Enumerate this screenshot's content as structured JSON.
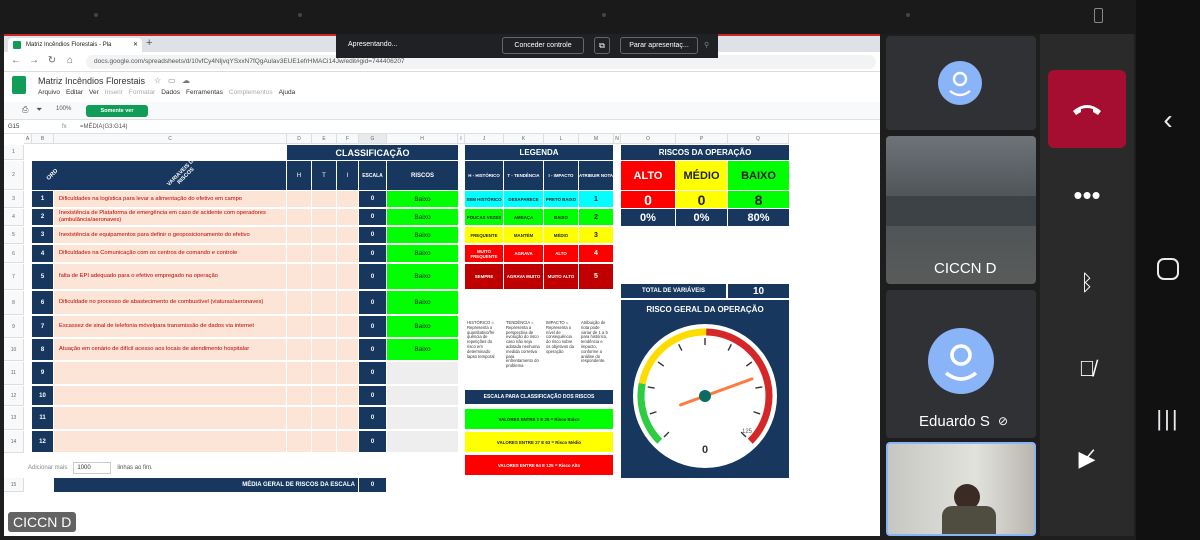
{
  "browser": {
    "tab_title": "Matriz Incêndios Florestais - Pla",
    "new_tab": "+",
    "url": "docs.google.com/spreadsheets/d/10vfCy4NljvqYSxxN7fQgAulav3EUE1efrHMACi14Jw/edit#gid=744406207"
  },
  "sheet": {
    "title": "Matriz Incêndios Florestais",
    "menu": [
      "Arquivo",
      "Editar",
      "Ver",
      "Inserir",
      "Formatar",
      "Dados",
      "Ferramentas",
      "Complementos",
      "Ajuda"
    ],
    "menu_dim": [
      3,
      4,
      7
    ],
    "zoom": "100%",
    "view_only": "Somente ver",
    "cell_ref": "G15",
    "formula": "=MÉDIA(G3:G14)",
    "columns": [
      "A",
      "B",
      "C",
      "D",
      "E",
      "F",
      "G",
      "H",
      "I",
      "J",
      "K",
      "L",
      "M",
      "N",
      "O",
      "P",
      "Q"
    ],
    "rows": [
      "1",
      "2",
      "3",
      "4",
      "5",
      "6",
      "7",
      "8",
      "9",
      "10",
      "11",
      "12",
      "13",
      "14",
      "15"
    ],
    "classificacao": "CLASSIFICAÇÃO",
    "col_ord": "ORD",
    "col_variaveis": "VARIÁVEIS DE RISCOS",
    "col_h": "H",
    "col_t": "T",
    "col_i": "I",
    "col_escala": "ESCALA",
    "col_riscos": "RISCOS",
    "items": [
      {
        "ord": "1",
        "text": "Dificuldades na logística para levar a alimentação do efetivo em campo",
        "escala": "0",
        "risco": "Baixo"
      },
      {
        "ord": "2",
        "text": "Inexistência de Plataforma de emergência em caso de acidente com operadores (ambulância/aeronaves)",
        "escala": "0",
        "risco": "Baixo"
      },
      {
        "ord": "3",
        "text": "Inexistência de equipamentos para definir o geoposicionamento do efetivo",
        "escala": "0",
        "risco": "Baixo"
      },
      {
        "ord": "4",
        "text": "Dificuldades na Comunicação com os centros de comando e controle",
        "escala": "0",
        "risco": "Baixo"
      },
      {
        "ord": "5",
        "text": "falta de EPI adequado para o efetivo empregado na operação",
        "escala": "0",
        "risco": "Baixo"
      },
      {
        "ord": "6",
        "text": "Dificuldade no processo de abastecimento de combustível (viaturas/aeronaves)",
        "escala": "0",
        "risco": "Baixo"
      },
      {
        "ord": "7",
        "text": "Escassez de sinal de telefonia móvelpara transmissão de dados via internet",
        "escala": "0",
        "risco": "Baixo"
      },
      {
        "ord": "8",
        "text": "Atuação em cenário de difícil acesso aos locais de atendimento hospitalar",
        "escala": "0",
        "risco": "Baixo"
      },
      {
        "ord": "9",
        "text": "",
        "escala": "0",
        "risco": ""
      },
      {
        "ord": "10",
        "text": "",
        "escala": "0",
        "risco": ""
      },
      {
        "ord": "11",
        "text": "",
        "escala": "0",
        "risco": ""
      },
      {
        "ord": "12",
        "text": "",
        "escala": "0",
        "risco": ""
      }
    ],
    "media_label": "MÉDIA GERAL DE RISCOS DA ESCALA",
    "media_value": "0",
    "legenda": {
      "title": "LEGENDA",
      "headers": [
        "H - HISTÓRICO",
        "T - TENDÊNCIA",
        "I - IMPACTO",
        "ATRIBUIR NOTA"
      ],
      "rows": [
        [
          "SEM HISTÓRICO",
          "DESAPARECE",
          "PRETO BAIXO",
          "1"
        ],
        [
          "POUCAS VEZES",
          "AMEAÇA",
          "BAIXO",
          "2"
        ],
        [
          "FREQUENTE",
          "MANTÉM",
          "MÉDIO",
          "3"
        ],
        [
          "MUITO FREQUENTE",
          "AGRAVA",
          "ALTO",
          "4"
        ],
        [
          "SEMPRE",
          "AGRAVA MUITO",
          "MUITO ALTO",
          "5"
        ]
      ],
      "colors": [
        [
          "#00ffff",
          "#00ffff",
          "#00ffff",
          "#00ffff"
        ],
        [
          "#00ff00",
          "#00ff00",
          "#00ff00",
          "#00ff00"
        ],
        [
          "#ffff00",
          "#ffff00",
          "#ffff00",
          "#ffff00"
        ],
        [
          "#ff0000",
          "#ff0000",
          "#ff0000",
          "#ff0000"
        ],
        [
          "#c00000",
          "#c00000",
          "#c00000",
          "#c00000"
        ]
      ],
      "notes": [
        "HISTÓRICO = Representa o quantitativo/fre quência de repetições do risco em determinado lapso temporal",
        "TENDÊNCIA = Representa a perspectiva de evolução do risco caso não seja adotada nenhuma medida corretiva para enfrentamento do problema",
        "IMPACTO = Representa o nível de consequência do risco sobre os objetivos da operação",
        "Atribuição de nota pode variar de 1 a 5 para histórico, tendência e impacto, conforme a análise do respondente."
      ],
      "escala_title": "ESCALA PARA CLASSIFICAÇÃO DOS RISCOS",
      "escala": [
        {
          "text": "VALORES ENTRE 1 E 26 = Risco Baixo",
          "color": "#00ff00"
        },
        {
          "text": "VALORES ENTRE 27 E 63 = Risco Médio",
          "color": "#ffff00"
        },
        {
          "text": "VALORES ENTRE 64 E 125 = Risco Alto",
          "color": "#ff0000"
        }
      ]
    },
    "riscos_op": {
      "title": "RISCOS DA OPERAÇÃO",
      "labels": [
        "ALTO",
        "MÉDIO",
        "BAIXO"
      ],
      "label_colors": [
        "#ff0000",
        "#ffff00",
        "#00ff00"
      ],
      "counts": [
        "0",
        "0",
        "8"
      ],
      "percents": [
        "0%",
        "0%",
        "80%"
      ],
      "total_label": "TOTAL DE VARIÁVEIS",
      "total_value": "10",
      "geral_title": "RISCO GERAL DA OPERAÇÃO",
      "gauge_value": "0",
      "gauge_max": "125",
      "gauge_level": 0
    },
    "add_more": "Adicionar mais",
    "add_rows": "1000",
    "rows_at_end": "linhas ao fim."
  },
  "presenting": {
    "label": "Apresentando...",
    "grant": "Conceder controle",
    "stop": "Parar apresentaç..."
  },
  "participants": [
    {
      "name": "CICCN D"
    },
    {
      "name": "Eduardo S"
    }
  ],
  "self_label": "CICCN D"
}
